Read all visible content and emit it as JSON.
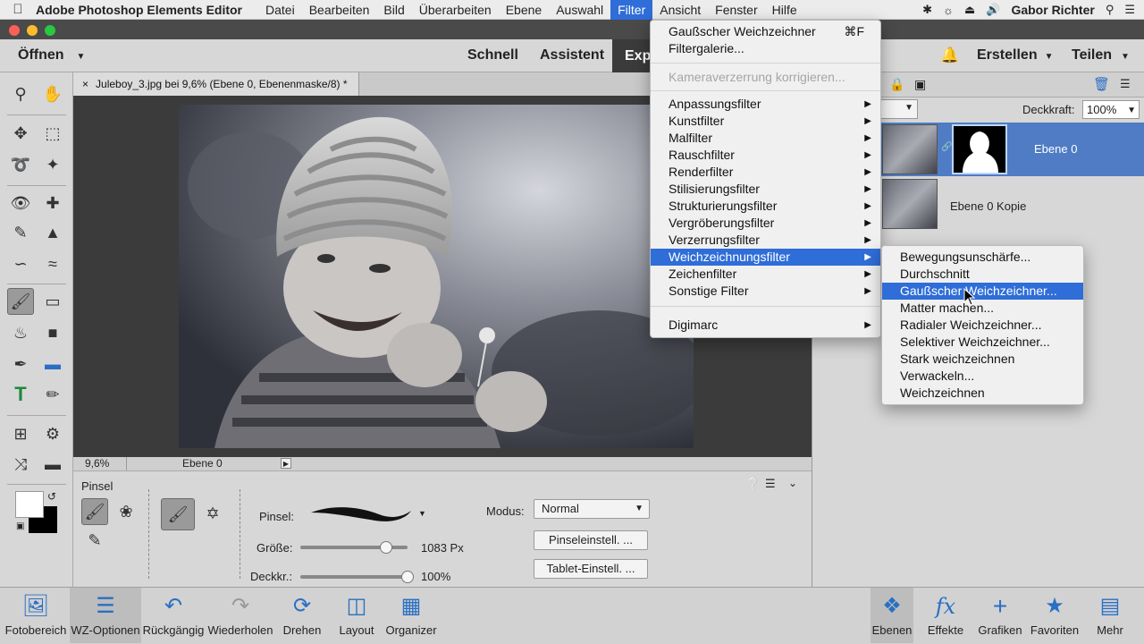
{
  "menubar": {
    "app": "Adobe Photoshop Elements Editor",
    "items": [
      "Datei",
      "Bearbeiten",
      "Bild",
      "Überarbeiten",
      "Ebene",
      "Auswahl",
      "Filter",
      "Ansicht",
      "Fenster",
      "Hilfe"
    ],
    "active": "Filter",
    "user": "Gabor Richter"
  },
  "modebar": {
    "open": "Öffnen",
    "modes": [
      "Schnell",
      "Assistent",
      "Exp"
    ],
    "create": "Erstellen",
    "share": "Teilen"
  },
  "document": {
    "tab_title": "Juleboy_3.jpg bei 9,6% (Ebene 0, Ebenenmaske/8) *",
    "zoom": "9,6%",
    "layer_status": "Ebene 0"
  },
  "layers": {
    "opacity_label": "Deckkraft:",
    "opacity_value": "100%",
    "items": [
      {
        "name": "Ebene 0"
      },
      {
        "name": "Ebene 0 Kopie"
      }
    ]
  },
  "tool_options": {
    "tool_name": "Pinsel",
    "brush_label": "Pinsel:",
    "size_label": "Größe:",
    "size_value": "1083 Px",
    "size_fraction": 0.8,
    "opacity_label": "Deckkr.:",
    "opacity_value": "100%",
    "opacity_fraction": 1.0,
    "mode_label": "Modus:",
    "mode_value": "Normal",
    "brush_settings": "Pinseleinstell. ...",
    "tablet_settings": "Tablet-Einstell. ..."
  },
  "bottombar": {
    "left": [
      "Fotobereich",
      "WZ-Optionen",
      "Rückgängig",
      "Wiederholen",
      "Drehen",
      "Layout",
      "Organizer"
    ],
    "right": [
      "Ebenen",
      "Effekte",
      "Grafiken",
      "Favoriten",
      "Mehr"
    ]
  },
  "filter_menu": {
    "last_filter": "Gaußscher Weichzeichner",
    "last_filter_shortcut": "⌘F",
    "gallery": "Filtergalerie...",
    "lens_correction": "Kameraverzerrung korrigieren...",
    "submenus": [
      "Anpassungsfilter",
      "Kunstfilter",
      "Malfilter",
      "Rauschfilter",
      "Renderfilter",
      "Stilisierungsfilter",
      "Strukturierungsfilter",
      "Vergröberungsfilter",
      "Verzerrungsfilter",
      "Weichzeichnungsfilter",
      "Zeichenfilter",
      "Sonstige Filter"
    ],
    "highlighted": "Weichzeichnungsfilter",
    "digimarc": "Digimarc"
  },
  "blur_submenu": {
    "items": [
      "Bewegungsunschärfe...",
      "Durchschnitt",
      "Gaußscher Weichzeichner...",
      "Matter machen...",
      "Radialer Weichzeichner...",
      "Selektiver Weichzeichner...",
      "Stark weichzeichnen",
      "Verwackeln...",
      "Weichzeichnen"
    ],
    "highlighted": "Gaußscher Weichzeichner..."
  },
  "colors": {
    "accent": "#2f6dd8",
    "icon_blue": "#2a6fc4"
  }
}
